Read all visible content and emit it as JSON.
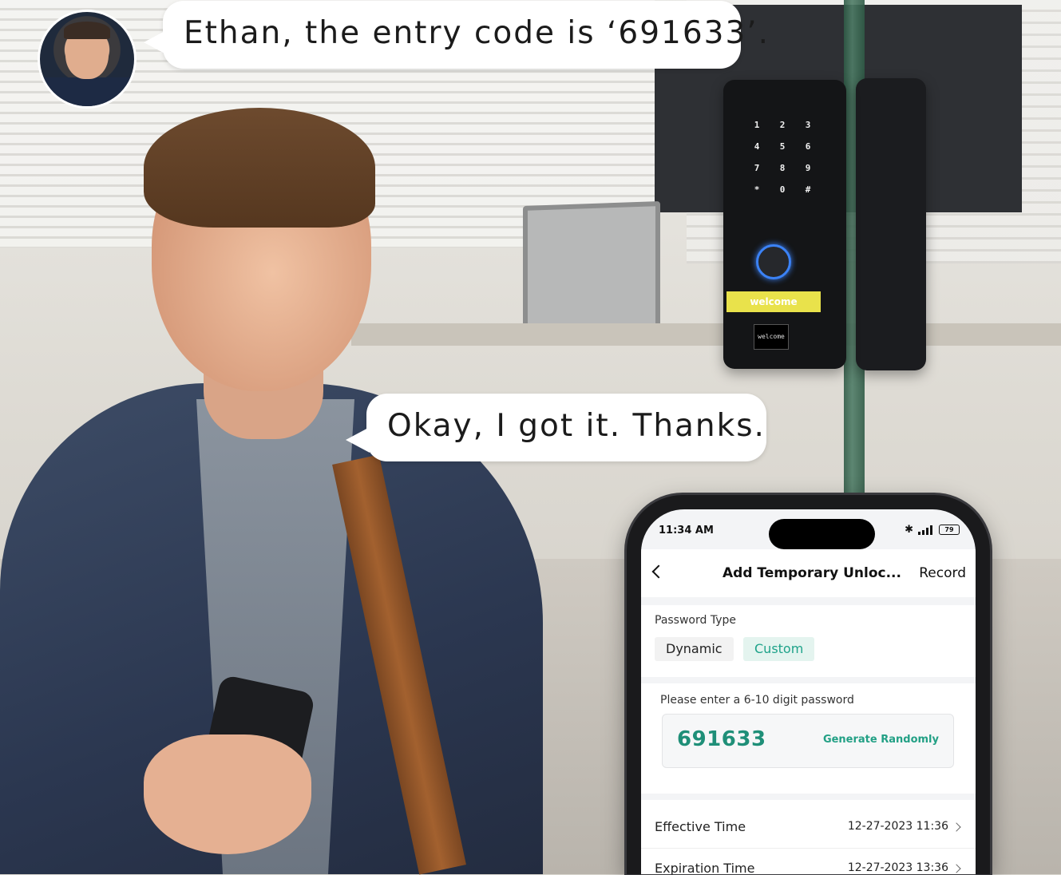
{
  "chat": {
    "message_1": "Ethan, the entry code is ‘691633’.",
    "message_2": "Okay, I got it. Thanks."
  },
  "lock": {
    "keys": [
      "1",
      "2",
      "3",
      "4",
      "5",
      "6",
      "7",
      "8",
      "9",
      "*",
      "0",
      "#"
    ],
    "band_text": "welcome",
    "screen_text": "welcome"
  },
  "phone": {
    "status_time": "11:34 AM",
    "battery": "79",
    "nav_title": "Add Temporary Unloc...",
    "nav_right": "Record",
    "password_type_label": "Password Type",
    "type_options": [
      "Dynamic",
      "Custom"
    ],
    "selected_type": "Custom",
    "password_prompt": "Please enter a 6-10 digit password",
    "password_value": "691633",
    "generate_label": "Generate Randomly",
    "effective_label": "Effective Time",
    "effective_value": "12-27-2023 11:36",
    "expiration_label": "Expiration Time",
    "expiration_value": "12-27-2023 13:36"
  },
  "colors": {
    "accent_green": "#1f8f78",
    "lock_band_yellow": "#e9e24b",
    "fingerprint_blue": "#3b82f6"
  }
}
